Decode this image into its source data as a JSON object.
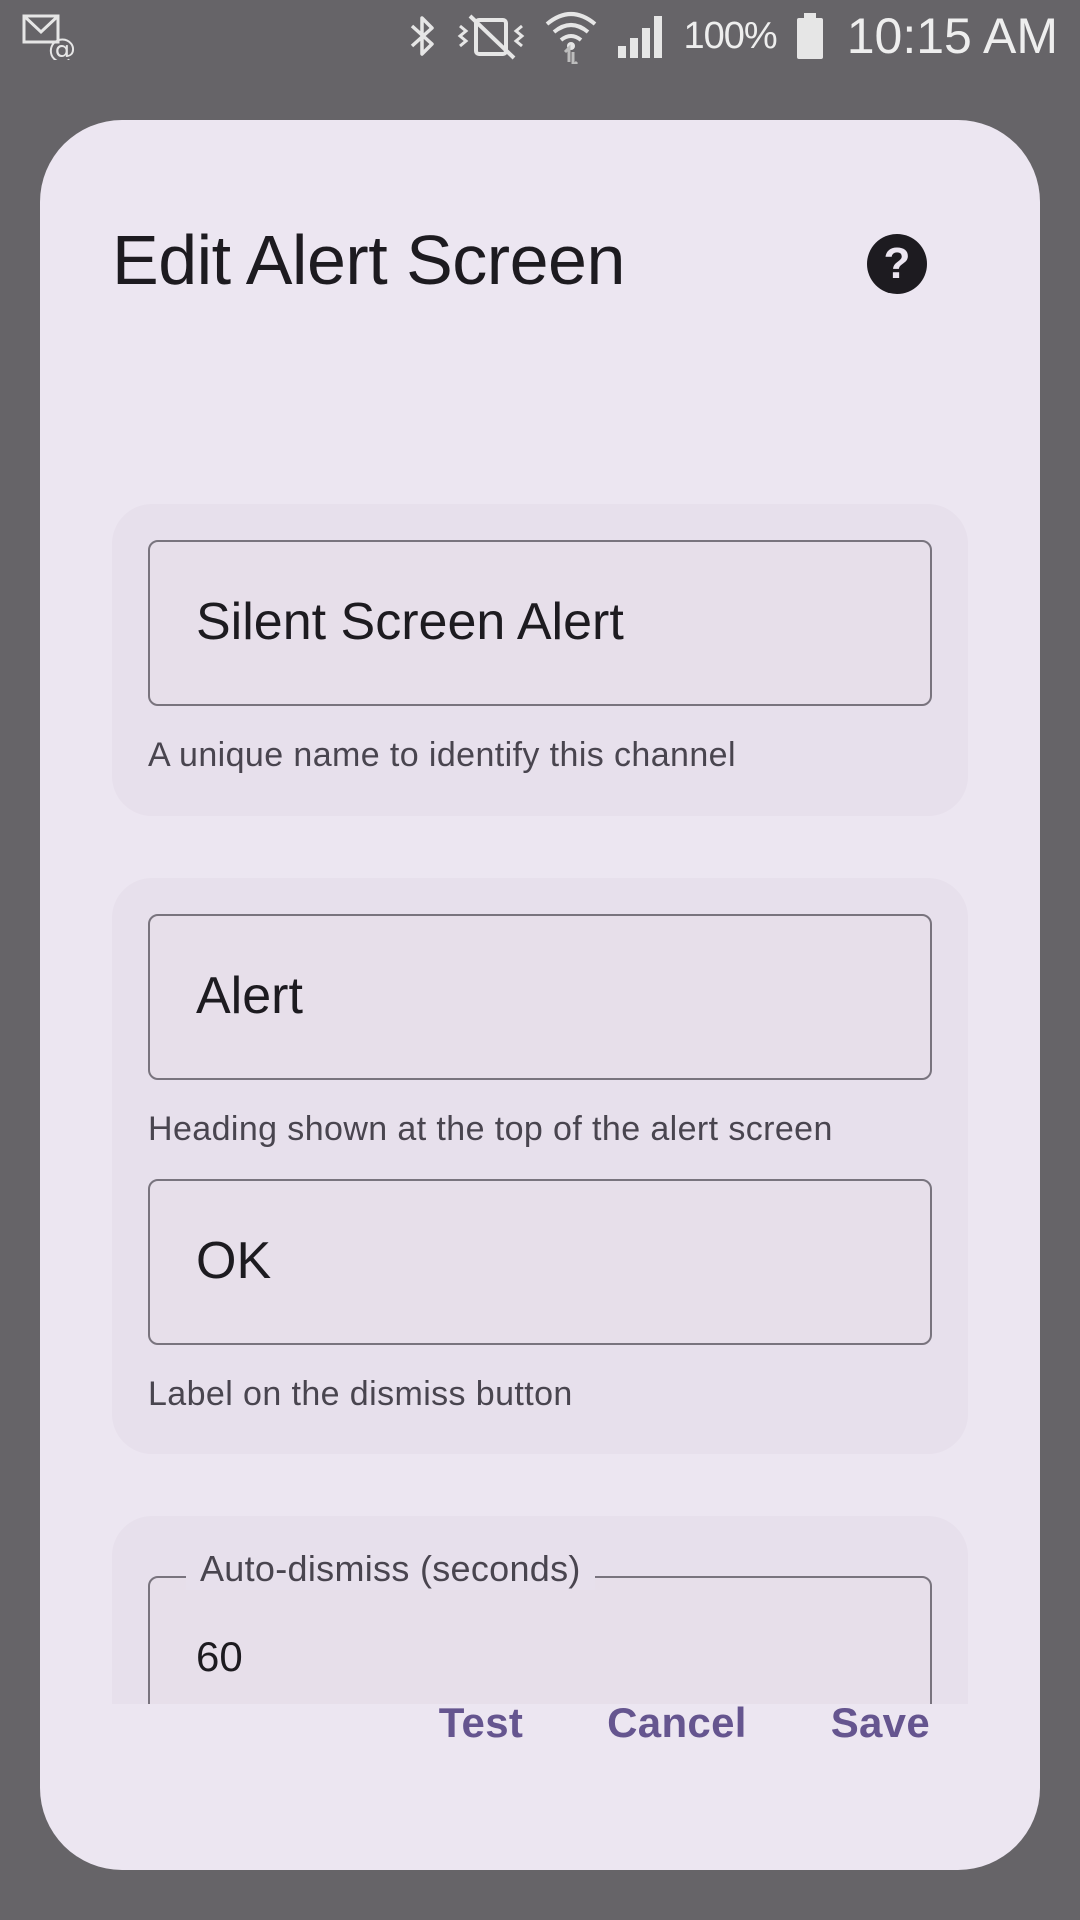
{
  "status_bar": {
    "icons": [
      "email-notification-icon",
      "bluetooth-icon",
      "vibrate-mute-icon",
      "wifi-icon",
      "signal-icon",
      "battery-icon"
    ],
    "battery_percent": "100%",
    "time": "10:15 AM"
  },
  "dialog": {
    "title": "Edit Alert Screen",
    "help_icon": "help-icon",
    "name_field": {
      "value": "Silent Screen Alert",
      "supporting_text": "A unique name to identify this channel"
    },
    "heading_field": {
      "value": "Alert",
      "supporting_text": "Heading shown at the top of the alert screen"
    },
    "dismiss_field": {
      "value": "OK",
      "supporting_text": "Label on the dismiss button"
    },
    "auto_dismiss_field": {
      "label": "Auto-dismiss (seconds)",
      "value": "60"
    },
    "actions": {
      "test": "Test",
      "cancel": "Cancel",
      "save": "Save"
    }
  },
  "colors": {
    "scrim": "#666468",
    "dialog_bg": "#ece6f1",
    "card_bg": "#e7e0ec",
    "outline": "#79747e",
    "primary": "#65558f",
    "on_surface": "#1d1b20"
  }
}
